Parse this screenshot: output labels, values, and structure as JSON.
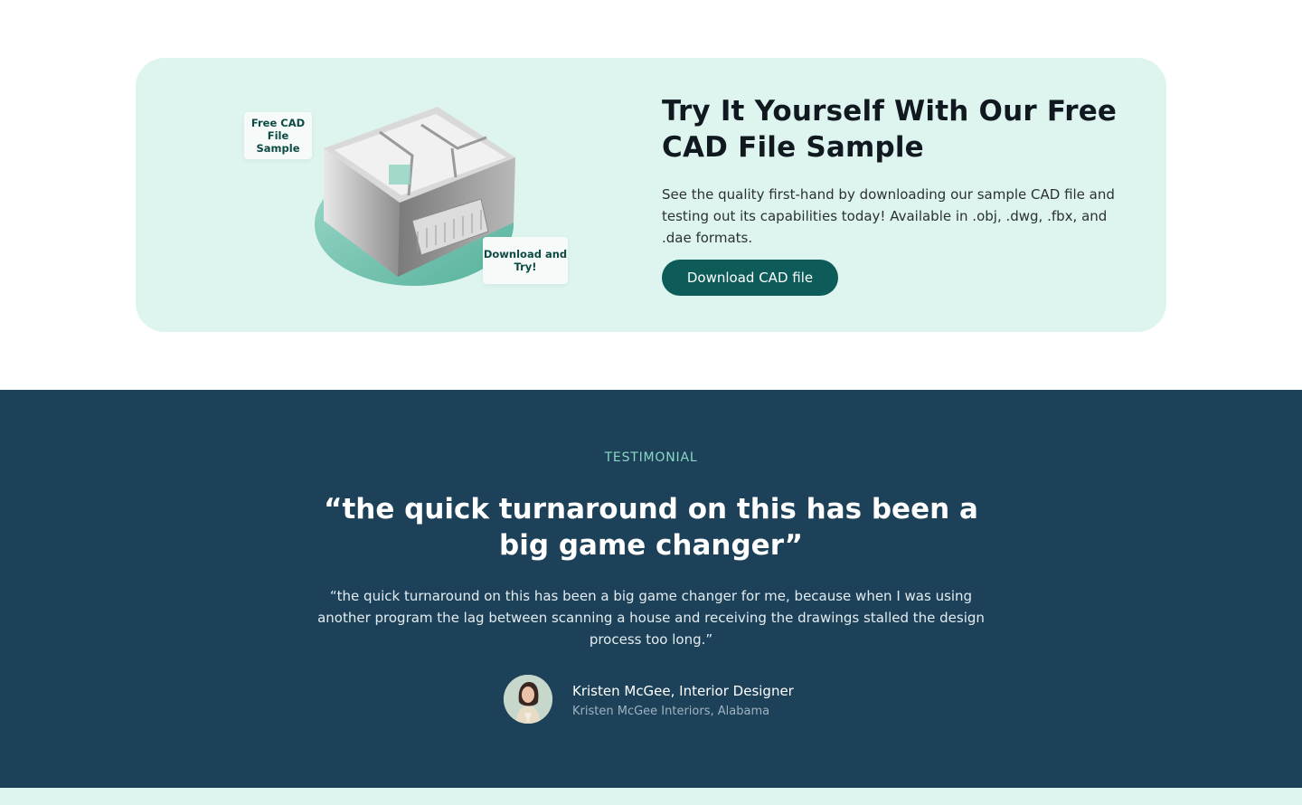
{
  "cad_sample": {
    "tag_free": "Free CAD File Sample",
    "tag_download": "Download and Try!",
    "title": "Try It Yourself With Our Free CAD File Sample",
    "description": "See the quality first-hand by downloading our sample CAD file and testing out its capabilities today! Available in .obj, .dwg, .fbx, and .dae formats.",
    "button_label": "Download CAD file"
  },
  "testimonial": {
    "eyebrow": "TESTIMONIAL",
    "headline": "“the quick turnaround on this has been a big game changer”",
    "quote": "“the quick turnaround on this has been a big game changer for me, because when I was using another program the lag between scanning a house and receiving the drawings stalled the design process too long.”",
    "author_name": "Kristen McGee, Interior Designer",
    "author_company": "Kristen McGee Interiors, Alabama"
  },
  "colors": {
    "card_bg": "#def4ee",
    "button_bg": "#0d5c59",
    "testimonial_bg": "#1c4158",
    "eyebrow": "#8ad8c5"
  }
}
